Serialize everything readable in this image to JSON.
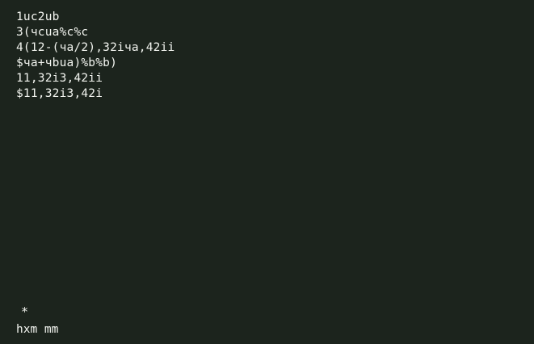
{
  "terminal": {
    "lines": [
      "1uc2ub",
      "3(чcua%c%c",
      "4(12-(чa/2),32iчa,42ii",
      "$чa+чbua)%b%b)",
      "11,32i3,42ii",
      "$11,32i3,42i"
    ],
    "cursor_mark": "*",
    "status_text": "hxm mm"
  },
  "colors": {
    "background": "#1c241d",
    "foreground": "#f2f4ef"
  }
}
